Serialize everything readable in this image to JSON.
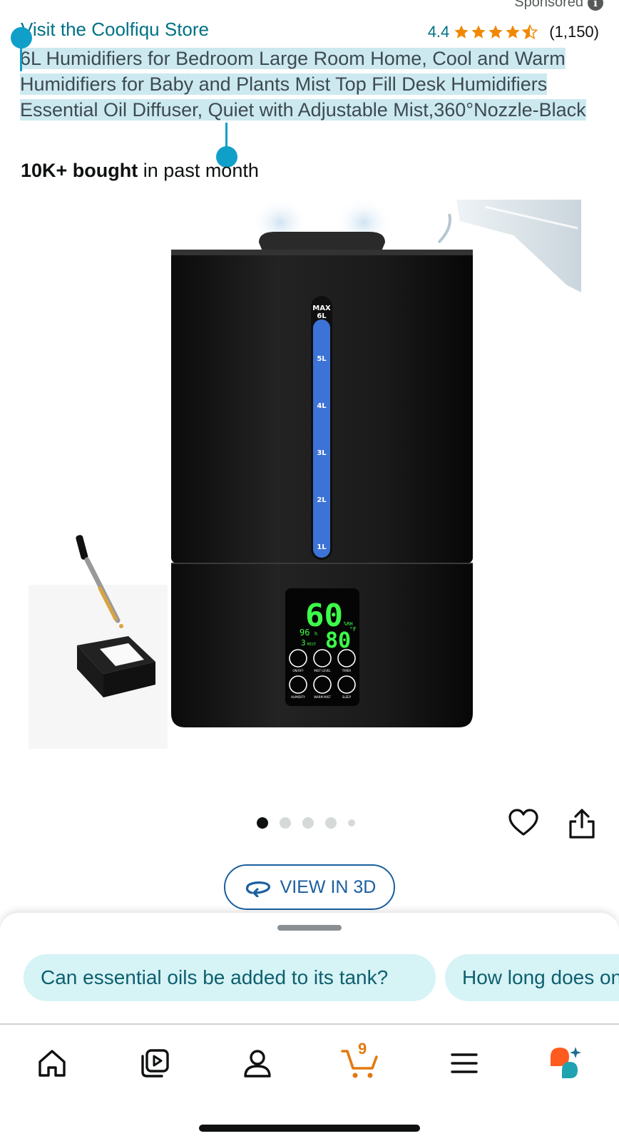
{
  "header": {
    "sponsored_label": "Sponsored",
    "store_link": "Visit the Coolfiqu Store",
    "rating_value": "4.4",
    "rating_stars": 4.4,
    "rating_count": "(1,150)"
  },
  "product": {
    "title": "6L Humidifiers for Bedroom Large Room Home, Cool and Warm Humidifiers for Baby and Plants Mist Top Fill Desk Humidifiers Essential Oil Diffuser, Quiet with Adjustable Mist,360°Nozzle-Black",
    "bought_bold": "10K+ bought",
    "bought_rest": " in past month"
  },
  "image": {
    "tank_marks": [
      "MAX",
      "6L",
      "5L",
      "4L",
      "3L",
      "2L",
      "1L"
    ],
    "display_humidity": "60",
    "display_humidity_unit": "%RH",
    "display_temp": "80",
    "display_temp_unit": "°F",
    "display_timer": "96",
    "display_timer_unit": "h",
    "display_mist": "3",
    "display_mist_unit": "MIST",
    "button_labels": [
      "ON/OFF",
      "MIST LEVEL",
      "TIMER",
      "HUMIDITY",
      "WARM MIST",
      "SLEEP"
    ]
  },
  "carousel": {
    "total": 5,
    "active_index": 0
  },
  "view3d": {
    "label": "VIEW IN 3D"
  },
  "questions": {
    "chips": [
      "Can essential oils be added to its tank?",
      "How long does one"
    ]
  },
  "tabbar": {
    "cart_count": "9",
    "tabs": [
      "home-icon",
      "video-icon",
      "account-icon",
      "cart-icon",
      "menu-icon",
      "rufus-icon"
    ]
  },
  "colors": {
    "link": "#007185",
    "star": "#f08804",
    "highlight": "#cde9f0",
    "selection_handle": "#0f9fc8",
    "chip_bg": "#d6f3f6",
    "cart": "#e47911"
  }
}
